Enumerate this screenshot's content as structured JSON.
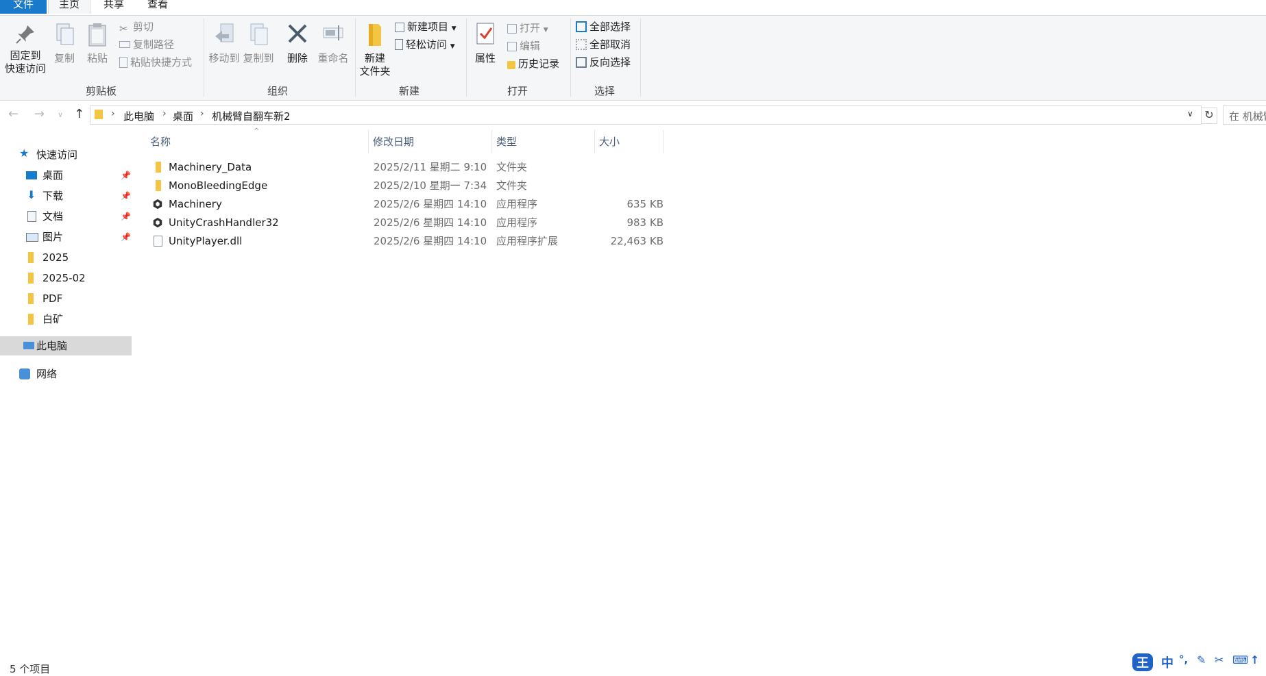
{
  "tabs": {
    "file": "文件",
    "home": "主页",
    "share": "共享",
    "view": "查看"
  },
  "ribbon": {
    "clipboard": {
      "label": "剪贴板",
      "pin": "固定到\n快速访问",
      "copy": "复制",
      "paste": "粘贴",
      "cut": "剪切",
      "copy_path": "复制路径",
      "paste_shortcut": "粘贴快捷方式"
    },
    "organize": {
      "label": "组织",
      "move_to": "移动到",
      "copy_to": "复制到",
      "delete": "删除",
      "rename": "重命名"
    },
    "new": {
      "label": "新建",
      "new_folder": "新建\n文件夹",
      "new_item": "新建项目",
      "easy_access": "轻松访问"
    },
    "open": {
      "label": "打开",
      "properties": "属性",
      "open": "打开",
      "edit": "编辑",
      "history": "历史记录"
    },
    "select": {
      "label": "选择",
      "select_all": "全部选择",
      "select_none": "全部取消",
      "invert": "反向选择"
    }
  },
  "address": {
    "crumbs": [
      "此电脑",
      "桌面",
      "机械臂自翻车新2"
    ],
    "search_placeholder": "在 机械臂"
  },
  "sidebar": {
    "quick_access": "快速访问",
    "items": [
      {
        "label": "桌面",
        "pinned": true
      },
      {
        "label": "下载",
        "pinned": true
      },
      {
        "label": "文档",
        "pinned": true
      },
      {
        "label": "图片",
        "pinned": true
      },
      {
        "label": "2025",
        "pinned": false
      },
      {
        "label": "2025-02",
        "pinned": false
      },
      {
        "label": "PDF",
        "pinned": false
      },
      {
        "label": "白矿",
        "pinned": false
      }
    ],
    "this_pc": "此电脑",
    "network": "网络"
  },
  "columns": {
    "name": "名称",
    "date": "修改日期",
    "type": "类型",
    "size": "大小"
  },
  "files": [
    {
      "name": "Machinery_Data",
      "date": "2025/2/11 星期二 9:10",
      "type": "文件夹",
      "size": "",
      "icon": "folder-icon"
    },
    {
      "name": "MonoBleedingEdge",
      "date": "2025/2/10 星期一 7:34",
      "type": "文件夹",
      "size": "",
      "icon": "folder-icon"
    },
    {
      "name": "Machinery",
      "date": "2025/2/6 星期四 14:10",
      "type": "应用程序",
      "size": "635 KB",
      "icon": "unity-icon"
    },
    {
      "name": "UnityCrashHandler32",
      "date": "2025/2/6 星期四 14:10",
      "type": "应用程序",
      "size": "983 KB",
      "icon": "unity-icon"
    },
    {
      "name": "UnityPlayer.dll",
      "date": "2025/2/6 星期四 14:10",
      "type": "应用程序扩展",
      "size": "22,463 KB",
      "icon": "dll-icon"
    }
  ],
  "status": {
    "count": "5 个项目"
  },
  "ime": {
    "logo": "王",
    "mode": "中",
    "punct": "°,"
  },
  "colors": {
    "accent": "#1979ca",
    "folder": "#f4c542",
    "selected": "#d9d9d9"
  }
}
